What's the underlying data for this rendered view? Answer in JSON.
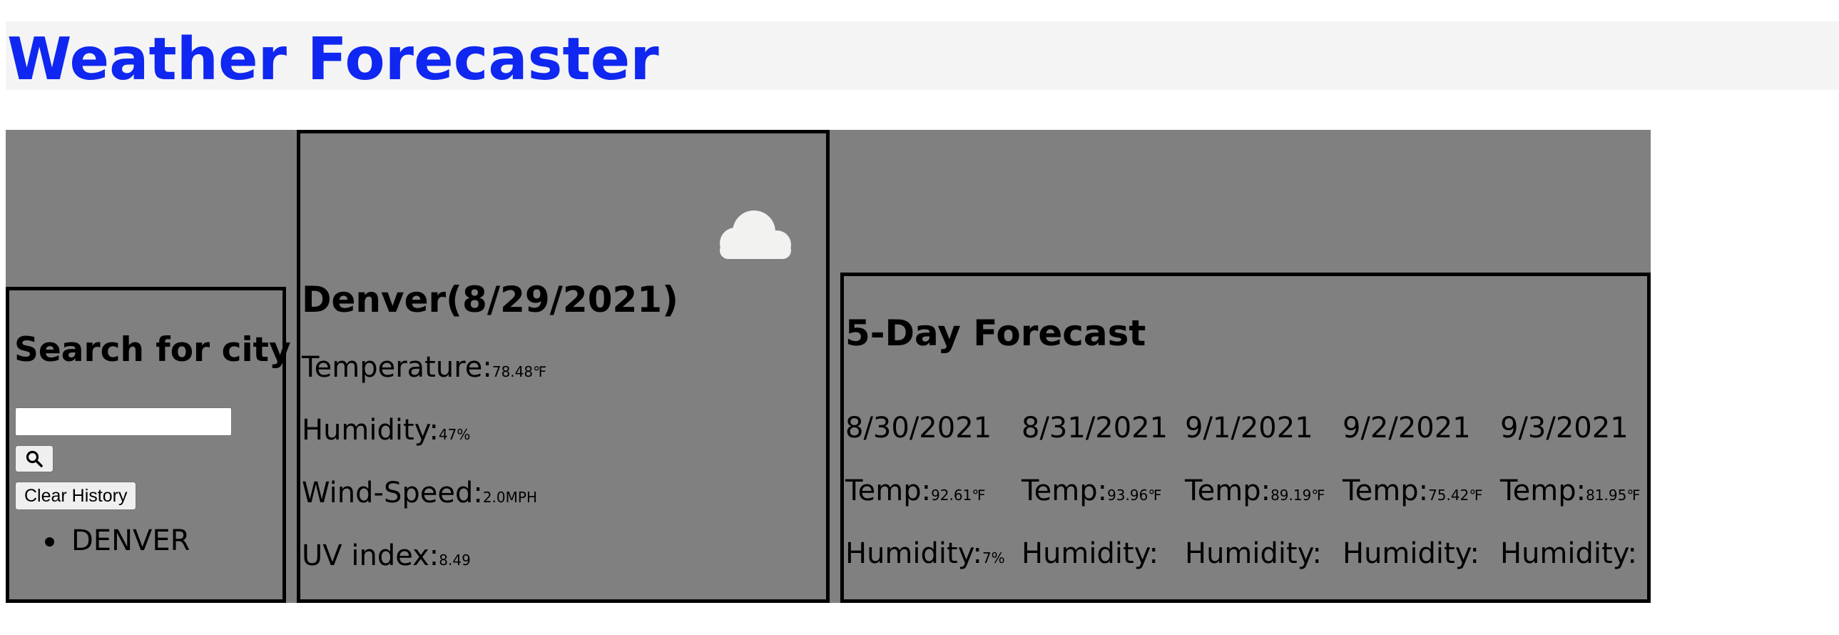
{
  "app": {
    "title": "Weather Forecaster"
  },
  "colors": {
    "title": "#0f27f0",
    "panel": "#808080",
    "header_band": "#f4f4f4"
  },
  "search": {
    "title": "Search for city",
    "input_value": "",
    "button_icon": "search-icon",
    "clear_label": "Clear History",
    "history": [
      "DENVER"
    ]
  },
  "current": {
    "city_title": "Denver(8/29/2021)",
    "icon": "cloud-icon",
    "temperature_label": "Temperature:",
    "temperature_value": "78.48℉",
    "humidity_label": "Humidity:",
    "humidity_value": "47%",
    "wind_label": "Wind-Speed:",
    "wind_value": "2.0MPH",
    "uv_label": "UV index:",
    "uv_value": "8.49"
  },
  "forecast": {
    "title": "5-Day Forecast",
    "days": [
      {
        "date": "8/30/2021",
        "temp_label": "Temp:",
        "temp_value": "92.61℉",
        "humidity_label": "Humidity:",
        "humidity_value": "7%"
      },
      {
        "date": "8/31/2021",
        "temp_label": "Temp:",
        "temp_value": "93.96℉",
        "humidity_label": "Humidity:",
        "humidity_value": ""
      },
      {
        "date": "9/1/2021",
        "temp_label": "Temp:",
        "temp_value": "89.19℉",
        "humidity_label": "Humidity:",
        "humidity_value": ""
      },
      {
        "date": "9/2/2021",
        "temp_label": "Temp:",
        "temp_value": "75.42℉",
        "humidity_label": "Humidity:",
        "humidity_value": ""
      },
      {
        "date": "9/3/2021",
        "temp_label": "Temp:",
        "temp_value": "81.95℉",
        "humidity_label": "Humidity:",
        "humidity_value": ""
      }
    ]
  }
}
